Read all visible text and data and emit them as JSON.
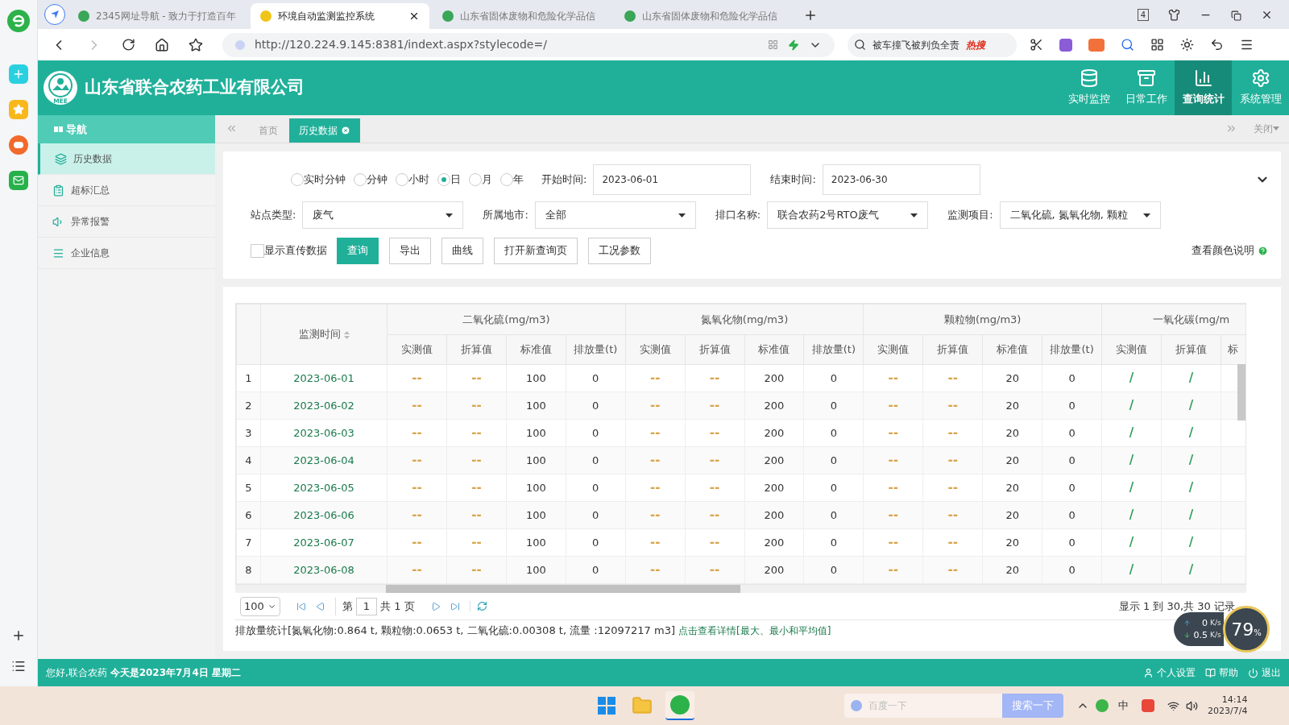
{
  "browser": {
    "tabs": [
      {
        "title": "2345网址导航 - 致力于打造百年",
        "selected": false
      },
      {
        "title": "环境自动监测监控系统",
        "selected": true
      },
      {
        "title": "山东省固体废物和危险化学品信",
        "selected": false
      },
      {
        "title": "山东省固体废物和危险化学品信",
        "selected": false
      }
    ],
    "tab_count": "4",
    "url": "http://120.224.9.145:8381/indext.aspx?stylecode=/",
    "search": {
      "value": "被车撞飞被判负全责",
      "badge": "热搜"
    }
  },
  "header": {
    "title": "山东省联合农药工业有限公司",
    "logo_text": "MEE",
    "menu": [
      {
        "label": "实时监控",
        "selected": false
      },
      {
        "label": "日常工作",
        "selected": false
      },
      {
        "label": "查询统计",
        "selected": true
      },
      {
        "label": "系统管理",
        "selected": false
      }
    ]
  },
  "sidebar": {
    "title": "导航",
    "items": [
      {
        "label": "历史数据",
        "selected": true
      },
      {
        "label": "超标汇总",
        "selected": false
      },
      {
        "label": "异常报警",
        "selected": false
      },
      {
        "label": "企业信息",
        "selected": false
      }
    ]
  },
  "page_tabs": [
    {
      "label": "首页",
      "selected": false
    },
    {
      "label": "历史数据",
      "selected": true
    }
  ],
  "close_menu": "关闭",
  "filters": {
    "periods": [
      {
        "label": "实时分钟",
        "selected": false
      },
      {
        "label": "分钟",
        "selected": false
      },
      {
        "label": "小时",
        "selected": false
      },
      {
        "label": "日",
        "selected": true
      },
      {
        "label": "月",
        "selected": false
      },
      {
        "label": "年",
        "selected": false
      }
    ],
    "start_label": "开始时间:",
    "start": "2023-06-01",
    "end_label": "结束时间:",
    "end": "2023-06-30",
    "selects": [
      {
        "label": "站点类型:",
        "value": "废气"
      },
      {
        "label": "所属地市:",
        "value": "全部"
      },
      {
        "label": "排口名称:",
        "value": "联合农药2号RTO废气"
      },
      {
        "label": "监测项目:",
        "value": "二氧化硫, 氮氧化物, 颗粒"
      }
    ],
    "show_raw": {
      "label": "显示直传数据",
      "checked": false
    },
    "buttons": [
      {
        "label": "查询",
        "primary": true
      },
      {
        "label": "导出",
        "primary": false
      },
      {
        "label": "曲线",
        "primary": false
      },
      {
        "label": "打开新查询页",
        "primary": false
      },
      {
        "label": "工况参数",
        "primary": false
      }
    ],
    "color_help": "查看颜色说明"
  },
  "table": {
    "time_header": "监测时间",
    "groups": [
      {
        "title": "二氧化硫(mg/m3)",
        "color": "#d9a449",
        "columns": [
          "实测值",
          "折算值",
          "标准值",
          "排放量(t)"
        ]
      },
      {
        "title": "氮氧化物(mg/m3)",
        "color": "#d9a449",
        "columns": [
          "实测值",
          "折算值",
          "标准值",
          "排放量(t)"
        ]
      },
      {
        "title": "颗粒物(mg/m3)",
        "color": "#d9a449",
        "columns": [
          "实测值",
          "折算值",
          "标准值",
          "排放量(t)"
        ]
      },
      {
        "title": "一氧化碳(mg/m",
        "color": "#2e9d5a",
        "columns": [
          "实测值",
          "折算值",
          "标"
        ]
      }
    ],
    "rows": [
      {
        "index": "1",
        "time": "2023-06-01",
        "values": [
          "--",
          "--",
          "100",
          "0",
          "--",
          "--",
          "200",
          "0",
          "--",
          "--",
          "20",
          "0",
          "/",
          "/"
        ]
      },
      {
        "index": "2",
        "time": "2023-06-02",
        "values": [
          "--",
          "--",
          "100",
          "0",
          "--",
          "--",
          "200",
          "0",
          "--",
          "--",
          "20",
          "0",
          "/",
          "/"
        ]
      },
      {
        "index": "3",
        "time": "2023-06-03",
        "values": [
          "--",
          "--",
          "100",
          "0",
          "--",
          "--",
          "200",
          "0",
          "--",
          "--",
          "20",
          "0",
          "/",
          "/"
        ]
      },
      {
        "index": "4",
        "time": "2023-06-04",
        "values": [
          "--",
          "--",
          "100",
          "0",
          "--",
          "--",
          "200",
          "0",
          "--",
          "--",
          "20",
          "0",
          "/",
          "/"
        ]
      },
      {
        "index": "5",
        "time": "2023-06-05",
        "values": [
          "--",
          "--",
          "100",
          "0",
          "--",
          "--",
          "200",
          "0",
          "--",
          "--",
          "20",
          "0",
          "/",
          "/"
        ]
      },
      {
        "index": "6",
        "time": "2023-06-06",
        "values": [
          "--",
          "--",
          "100",
          "0",
          "--",
          "--",
          "200",
          "0",
          "--",
          "--",
          "20",
          "0",
          "/",
          "/"
        ]
      },
      {
        "index": "7",
        "time": "2023-06-07",
        "values": [
          "--",
          "--",
          "100",
          "0",
          "--",
          "--",
          "200",
          "0",
          "--",
          "--",
          "20",
          "0",
          "/",
          "/"
        ]
      },
      {
        "index": "8",
        "time": "2023-06-08",
        "values": [
          "--",
          "--",
          "100",
          "0",
          "--",
          "--",
          "200",
          "0",
          "--",
          "--",
          "20",
          "0",
          "/",
          "/"
        ]
      }
    ]
  },
  "pager": {
    "page_size": "100",
    "page_label": "第",
    "page": "1",
    "total_label": "共 1 页",
    "summary": "显示 1 到 30,共 30 记录"
  },
  "stats": {
    "text": "排放量统计[氮氧化物:0.864 t, 颗粒物:0.0653 t, 二氧化硫:0.00308 t, 流量 :12097217 m3]",
    "link": "点击查看详情[最大、最小和平均值]"
  },
  "status_bar": {
    "greeting": "您好,联合农药 **今天是2023年7月4日 星期二**",
    "actions": [
      "个人设置",
      "帮助",
      "退出"
    ]
  },
  "speed_widget": {
    "up": "0",
    "up_unit": "K/s",
    "down": "0.5",
    "down_unit": "K/s",
    "percent": "79",
    "percent_unit": "%"
  },
  "taskbar": {
    "search_placeholder": "百度一下",
    "search_button": "搜索一下",
    "ime": "中",
    "time": "14:14",
    "date": "2023/7/4"
  }
}
